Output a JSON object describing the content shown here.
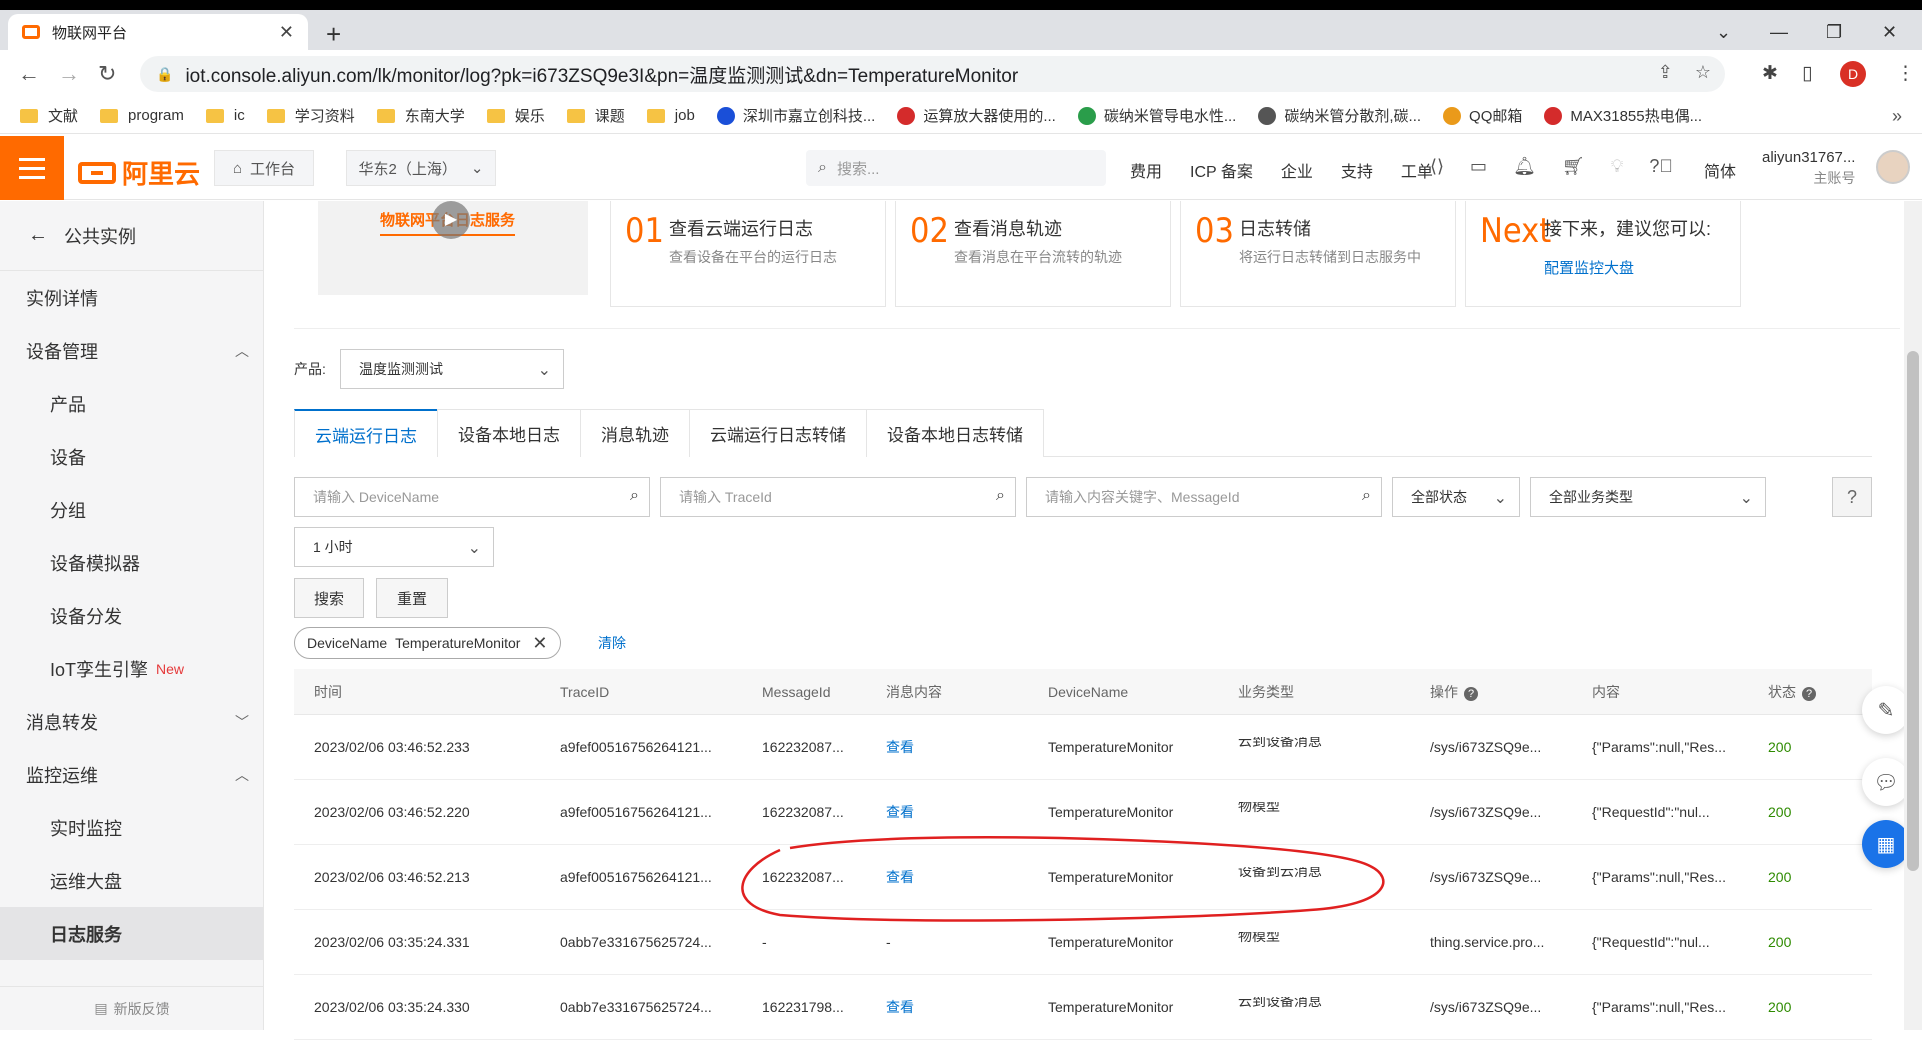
{
  "browser": {
    "tab_title": "物联网平台",
    "url": "iot.console.aliyun.com/lk/monitor/log?pk=i673ZSQ9e3I&pn=温度监测测试&dn=TemperatureMonitor",
    "profile_initial": "D",
    "bookmarks": [
      "文献",
      "program",
      "ic",
      "学习资料",
      "东南大学",
      "娱乐",
      "课题",
      "job",
      "深圳市嘉立创科技...",
      "运算放大器使用的...",
      "碳纳米管导电水性...",
      "碳纳米管分散剂,碳...",
      "QQ邮箱",
      "MAX31855热电偶..."
    ],
    "bookmark_more": "»"
  },
  "topnav": {
    "logo": "阿里云",
    "workbench": "工作台",
    "region": "华东2（上海）",
    "search_placeholder": "搜索...",
    "links": [
      "费用",
      "ICP 备案",
      "企业",
      "支持",
      "工单"
    ],
    "lang": "简体",
    "user": "aliyun31767...",
    "user_sub": "主账号"
  },
  "sidebar": {
    "back": "公共实例",
    "items": [
      {
        "label": "实例详情",
        "level": 1
      },
      {
        "label": "设备管理",
        "level": 1,
        "chevron": "up"
      },
      {
        "label": "产品",
        "level": 2
      },
      {
        "label": "设备",
        "level": 2
      },
      {
        "label": "分组",
        "level": 2
      },
      {
        "label": "设备模拟器",
        "level": 2
      },
      {
        "label": "设备分发",
        "level": 2
      },
      {
        "label": "IoT孪生引擎",
        "level": 2,
        "tag": "New"
      },
      {
        "label": "消息转发",
        "level": 1,
        "chevron": "down"
      },
      {
        "label": "监控运维",
        "level": 1,
        "chevron": "up"
      },
      {
        "label": "实时监控",
        "level": 2
      },
      {
        "label": "运维大盘",
        "level": 2
      },
      {
        "label": "日志服务",
        "level": 2,
        "active": true
      }
    ],
    "feedback": "新版反馈"
  },
  "guide": {
    "video_title": "物联网平台日志服务",
    "steps": [
      {
        "num": "01",
        "title": "查看云端运行日志",
        "desc": "查看设备在平台的运行日志"
      },
      {
        "num": "02",
        "title": "查看消息轨迹",
        "desc": "查看消息在平台流转的轨迹"
      },
      {
        "num": "03",
        "title": "日志转储",
        "desc": "将运行日志转储到日志服务中"
      }
    ],
    "next": {
      "num": "Next",
      "title": "接下来，建议您可以:",
      "link": "配置监控大盘"
    }
  },
  "filters": {
    "product_label": "产品:",
    "product_value": "温度监测测试",
    "tabs": [
      "云端运行日志",
      "设备本地日志",
      "消息轨迹",
      "云端运行日志转储",
      "设备本地日志转储"
    ],
    "devicename_placeholder": "请输入 DeviceName",
    "traceid_placeholder": "请输入 TraceId",
    "keyword_placeholder": "请输入内容关键字、MessageId",
    "status": "全部状态",
    "biztype": "全部业务类型",
    "time": "1 小时",
    "search_btn": "搜索",
    "reset_btn": "重置",
    "chip_key": "DeviceName",
    "chip_value": "TemperatureMonitor",
    "clear": "清除"
  },
  "table": {
    "headers": [
      "时间",
      "TraceID",
      "MessageId",
      "消息内容",
      "DeviceName",
      "业务类型",
      "操作",
      "内容",
      "状态"
    ],
    "rows": [
      [
        "2023/02/06 03:46:52.233",
        "a9fef00516756264121...",
        "162232087...",
        "查看",
        "TemperatureMonitor",
        "云到设备消息",
        "/sys/i673ZSQ9e...",
        "{\"Params\":null,\"Res...",
        "200"
      ],
      [
        "2023/02/06 03:46:52.220",
        "a9fef00516756264121...",
        "162232087...",
        "查看",
        "TemperatureMonitor",
        "物模型",
        "/sys/i673ZSQ9e...",
        "{\"RequestId\":\"nul...",
        "200"
      ],
      [
        "2023/02/06 03:46:52.213",
        "a9fef00516756264121...",
        "162232087...",
        "查看",
        "TemperatureMonitor",
        "设备到云消息",
        "/sys/i673ZSQ9e...",
        "{\"Params\":null,\"Res...",
        "200"
      ],
      [
        "2023/02/06 03:35:24.331",
        "0abb7e331675625724...",
        "-",
        "-",
        "TemperatureMonitor",
        "物模型",
        "thing.service.pro...",
        "{\"RequestId\":\"nul...",
        "200"
      ],
      [
        "2023/02/06 03:35:24.330",
        "0abb7e331675625724...",
        "162231798...",
        "查看",
        "TemperatureMonitor",
        "云到设备消息",
        "/sys/i673ZSQ9e...",
        "{\"Params\":null,\"Res...",
        "200"
      ]
    ]
  },
  "colors": {
    "accent": "#ff6a00",
    "link": "#0070cc",
    "ok": "#2e8b00",
    "annotation": "#e02020"
  }
}
